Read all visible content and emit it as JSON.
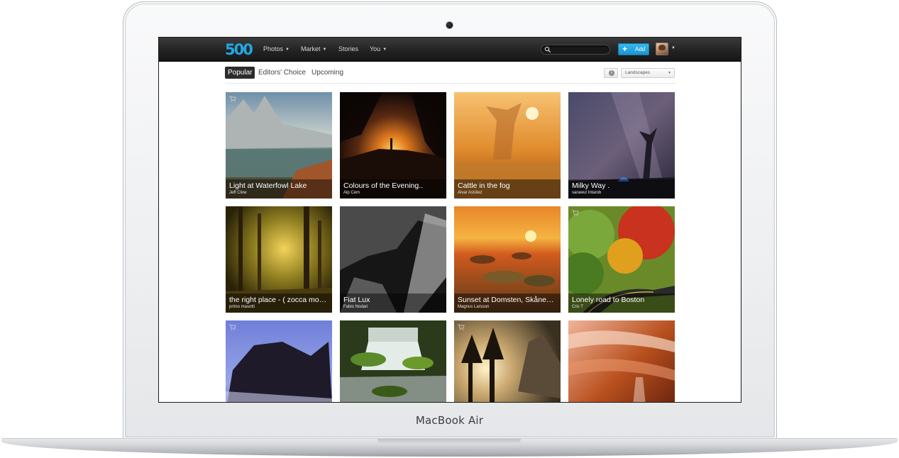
{
  "device": {
    "brand": "MacBook Air"
  },
  "topbar": {
    "logo": "500",
    "nav": [
      {
        "label": "Photos",
        "dropdown": true
      },
      {
        "label": "Market",
        "dropdown": true
      },
      {
        "label": "Stories",
        "dropdown": false
      },
      {
        "label": "You",
        "dropdown": true
      }
    ],
    "search": {
      "placeholder": "",
      "icon": "search-icon"
    },
    "add_button": {
      "label": "Add",
      "icon": "plus-icon"
    },
    "avatar": {
      "icon": "user-avatar"
    }
  },
  "subnav": {
    "tabs": [
      {
        "label": "Popular",
        "active": true
      },
      {
        "label": "Editors' Choice",
        "active": false
      },
      {
        "label": "Upcoming",
        "active": false
      }
    ],
    "category": "Landscapes"
  },
  "photos": [
    {
      "title": "Light at Waterfowl Lake",
      "author": "Jeff Clow",
      "for_sale": true
    },
    {
      "title": "Colours of the Evening..",
      "author": "Alp Cem",
      "for_sale": false
    },
    {
      "title": "Cattle in the fog",
      "author": "Alvar Astúlez",
      "for_sale": false
    },
    {
      "title": "Milky Way .",
      "author": "sarawut Intarob",
      "for_sale": false
    },
    {
      "title": "the right place - ( zocca mo…",
      "author": "primo masotti",
      "for_sale": false
    },
    {
      "title": "Fiat Lux",
      "author": "Fabio Nodari",
      "for_sale": false
    },
    {
      "title": "Sunset at Domsten, Skåne…",
      "author": "Magnus Larsson",
      "for_sale": false
    },
    {
      "title": "Lonely road to Boston",
      "author": "Cris T",
      "for_sale": true
    },
    {
      "title": "",
      "author": "",
      "for_sale": true
    },
    {
      "title": "",
      "author": "",
      "for_sale": false
    },
    {
      "title": "",
      "author": "",
      "for_sale": true
    },
    {
      "title": "",
      "author": "",
      "for_sale": false
    }
  ],
  "colors": {
    "accent": "#22a7e0",
    "topbar": "#1e1e1e",
    "add_button": "#2aa6e2"
  }
}
